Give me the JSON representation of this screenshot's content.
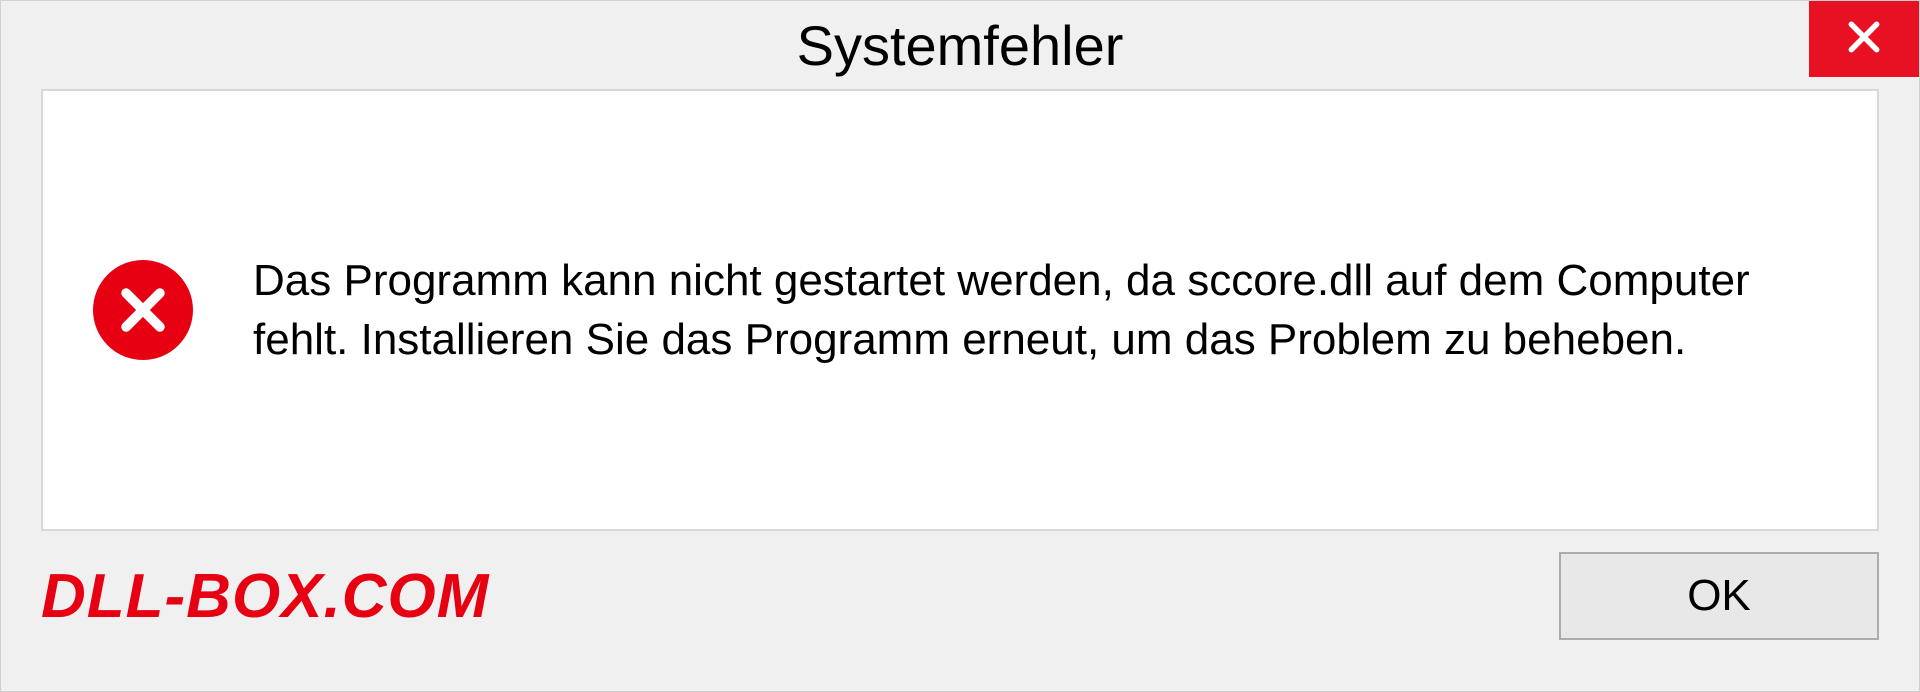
{
  "window": {
    "title": "Systemfehler"
  },
  "error": {
    "message": "Das Programm kann nicht gestartet werden, da sccore.dll auf dem Computer fehlt. Installieren Sie das Programm erneut, um das Problem zu beheben."
  },
  "footer": {
    "watermark": "DLL-BOX.COM",
    "ok_label": "OK"
  },
  "colors": {
    "error_red": "#e60012",
    "close_red": "#e81123"
  }
}
